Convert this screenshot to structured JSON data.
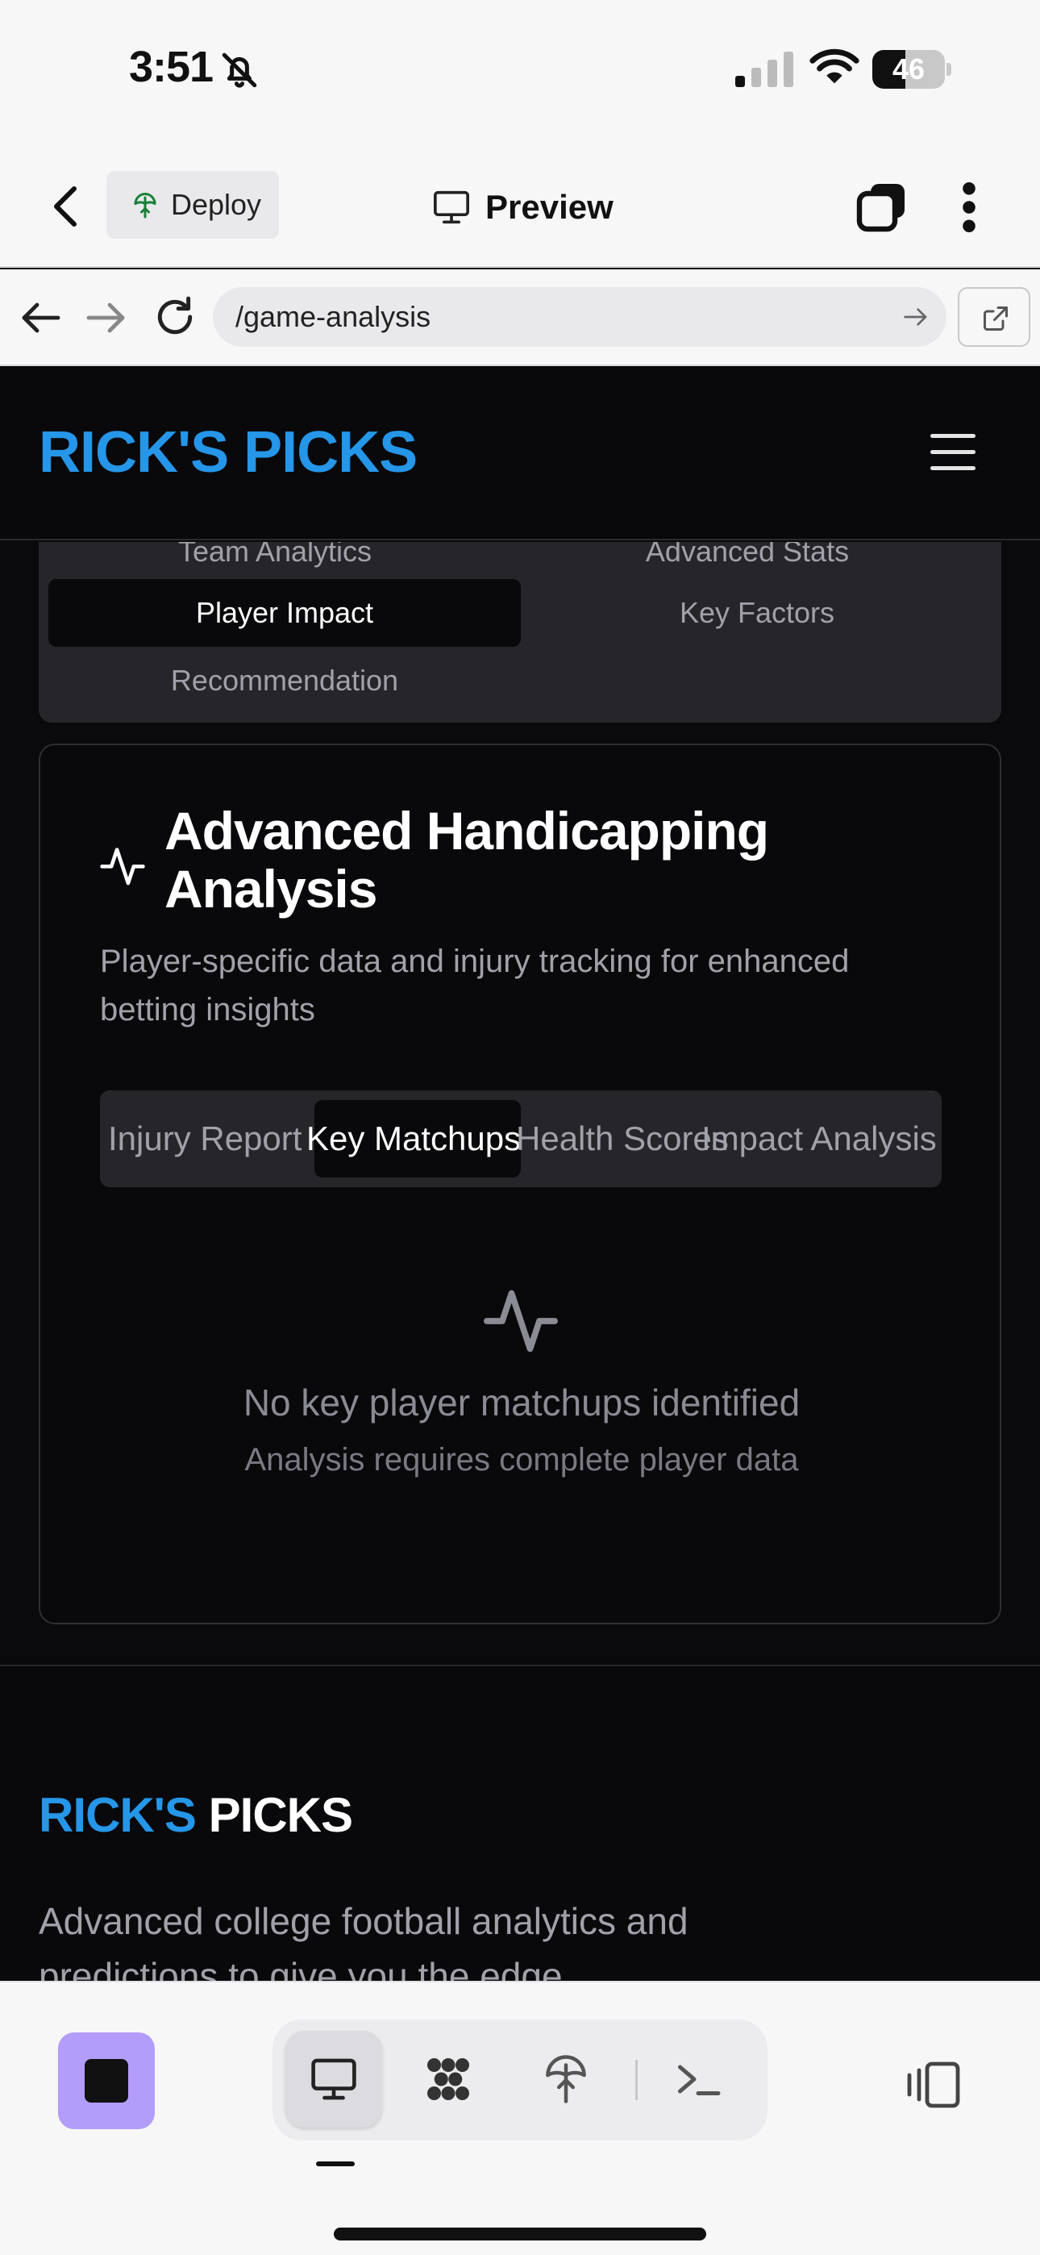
{
  "status_bar": {
    "time": "3:51",
    "battery": "46",
    "battery_level": 0.46
  },
  "app_header": {
    "deploy_label": "Deploy",
    "preview_label": "Preview"
  },
  "browser": {
    "url": "/game-analysis"
  },
  "site": {
    "logo": "RICK'S PICKS"
  },
  "analysis_tabs": {
    "items": [
      "Team Analytics",
      "Advanced Stats",
      "Player Impact",
      "Key Factors",
      "Recommendation"
    ],
    "active": "Player Impact"
  },
  "card": {
    "title": "Advanced Handicapping Analysis",
    "description": "Player-specific data and injury tracking for enhanced betting insights",
    "subtabs": [
      "Injury Report",
      "Key Matchups",
      "Health Scores",
      "Impact Analysis"
    ],
    "active_subtab": "Key Matchups",
    "empty_title": "No key player matchups identified",
    "empty_subtitle": "Analysis requires complete player data"
  },
  "footer": {
    "logo_part1": "RICK'S",
    "logo_part2": "PICKS",
    "description": "Advanced college football analytics and predictions to give you the edge."
  },
  "colors": {
    "brand_blue": "#2596e8",
    "page_bg": "#09090b",
    "stop_button": "#b39dfa"
  },
  "icons": [
    "bell-off-icon",
    "signal-icon",
    "wifi-icon",
    "battery-icon",
    "back-chevron-icon",
    "deploy-icon",
    "monitor-icon",
    "tabs-icon",
    "more-icon",
    "arrow-left-icon",
    "arrow-right-icon",
    "reload-icon",
    "open-external-icon",
    "menu-icon",
    "activity-icon",
    "stop-icon",
    "preview-tool-icon",
    "workflows-icon",
    "deployments-icon",
    "console-icon",
    "panel-toggle-icon"
  ]
}
